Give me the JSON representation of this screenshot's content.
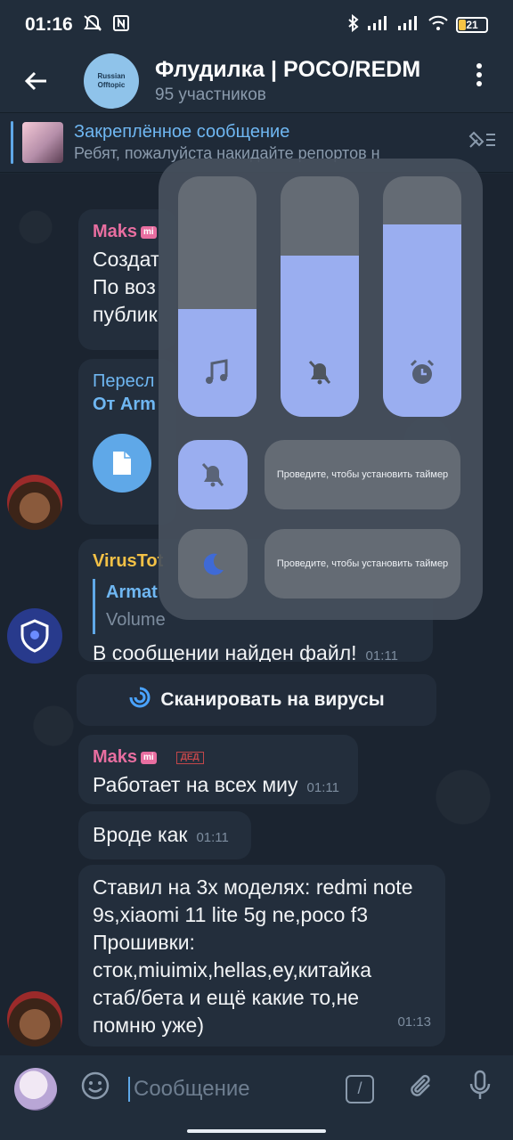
{
  "status_bar": {
    "time": "01:16",
    "left_icons": [
      "mute-icon",
      "nfc-icon"
    ],
    "right_icons": [
      "bluetooth-icon",
      "signal-icon",
      "signal-icon",
      "wifi-icon"
    ],
    "battery": "21"
  },
  "header": {
    "title": "Флудилка | POCO/REDM",
    "subtitle": "95 участников",
    "avatar_text_top": "Russian",
    "avatar_text_bottom": "Offtopic"
  },
  "pinned": {
    "title": "Закреплённое сообщение",
    "preview": "Ребят, пожалуйста накидайте репортов н"
  },
  "messages": [
    {
      "sender": "Maks",
      "lines": [
        "Создат",
        "По воз",
        "публик"
      ]
    },
    {
      "forward_label": "Пересл",
      "forward_from": "От Arm"
    },
    {
      "sender": "VirusTot",
      "quote_title": "Armat",
      "quote_sub": "Volume",
      "text": "В сообщении найден файл!",
      "time": "01:11"
    },
    {
      "sender": "Maks",
      "role": "ДЕД",
      "text": "Работает на всех миу",
      "time": "01:11"
    },
    {
      "text": "Вроде как",
      "time": "01:11"
    },
    {
      "lines": [
        "Ставил на 3х моделях: redmi note",
        "9s,xiaomi 11 lite 5g ne,poco f3",
        "Прошивки:",
        "сток,miuimix,hellas,ey,китайка",
        "стаб/бета и ещё какие то,не",
        "помню уже)"
      ],
      "time": "01:13"
    }
  ],
  "scan_button": "Сканировать на вирусы",
  "input": {
    "placeholder": "Сообщение",
    "command_label": "/"
  },
  "volume_panel": {
    "sliders": [
      {
        "icon": "music-note-icon",
        "level": 0.45
      },
      {
        "icon": "bell-off-icon",
        "level": 0.67
      },
      {
        "icon": "alarm-icon",
        "level": 0.8
      }
    ],
    "rows": [
      {
        "icon": "bell-off-icon",
        "label": "Проведите, чтобы установить таймер"
      },
      {
        "icon": "moon-icon",
        "label": "Проведите, чтобы установить таймер"
      }
    ],
    "colors": {
      "accent": "#9aaef0",
      "track": "#646b74"
    }
  }
}
